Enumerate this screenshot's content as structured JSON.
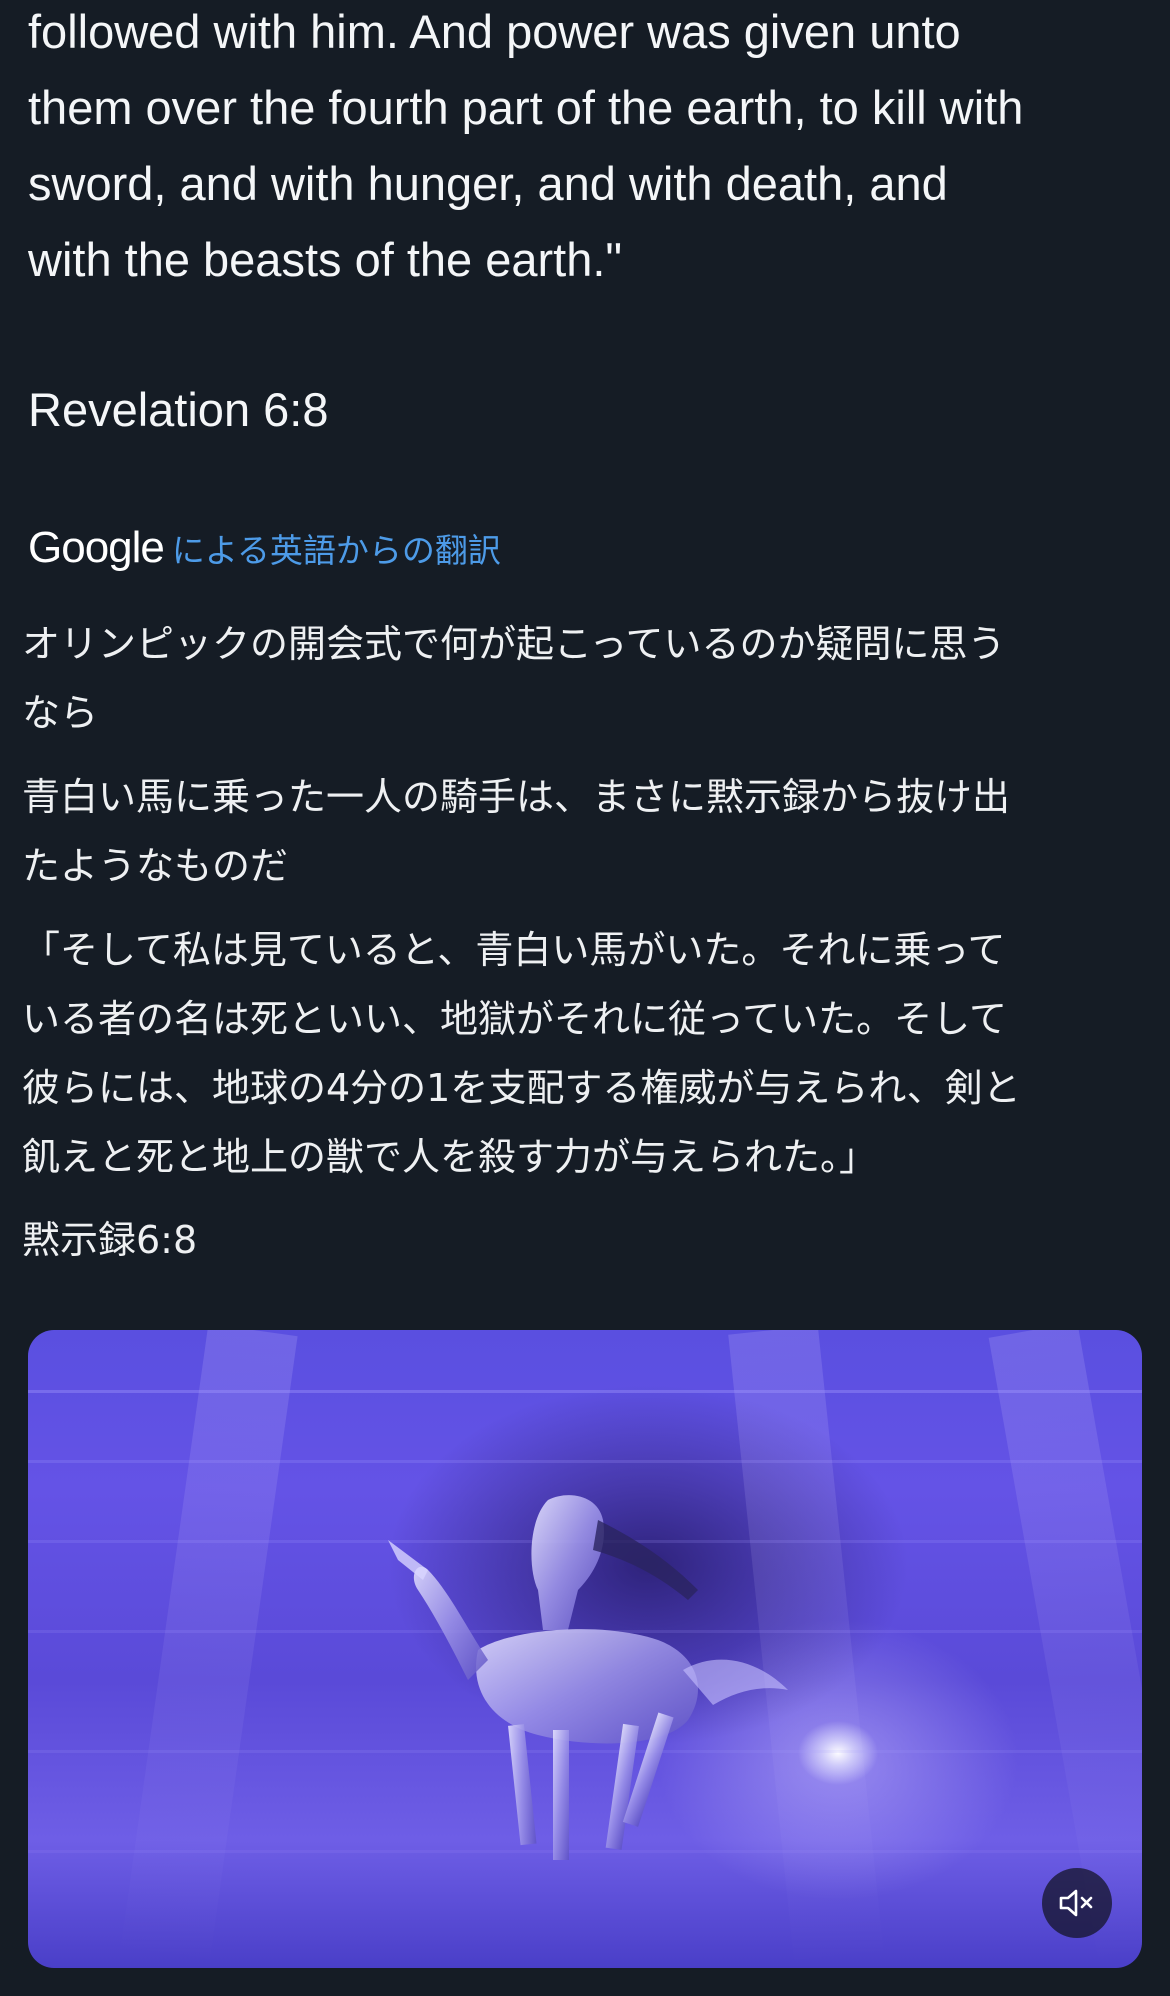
{
  "post": {
    "original_lines": [
      "followed with him. And power was given unto",
      "them over the fourth part of the earth, to kill with",
      "sword, and with hunger, and with death, and",
      "with the beasts of the earth.\""
    ],
    "reference": "Revelation 6:8",
    "translation": {
      "brand": "Google",
      "link_text": "による英語からの翻訳"
    },
    "translated": {
      "p1": [
        "オリンピックの開会式で何が起こっているのか疑問に思う",
        "なら"
      ],
      "p2": [
        "青白い馬に乗った一人の騎手は、まさに黙示録から抜け出",
        "たようなものだ"
      ],
      "p3": [
        "「そして私は見ていると、青白い馬がいた。それに乗って",
        "いる者の名は死といい、地獄がそれに従っていた。そして",
        "彼らには、地球の4分の1を支配する権威が与えられ、剣と",
        "飢えと死と地上の獣で人を殺す力が与えられた。」"
      ],
      "p4": "黙示録6:8"
    },
    "media": {
      "mute_icon": "speaker-muted-icon"
    }
  },
  "colors": {
    "background": "#151c25",
    "text": "#f4f6f8",
    "link": "#4d9be8"
  }
}
